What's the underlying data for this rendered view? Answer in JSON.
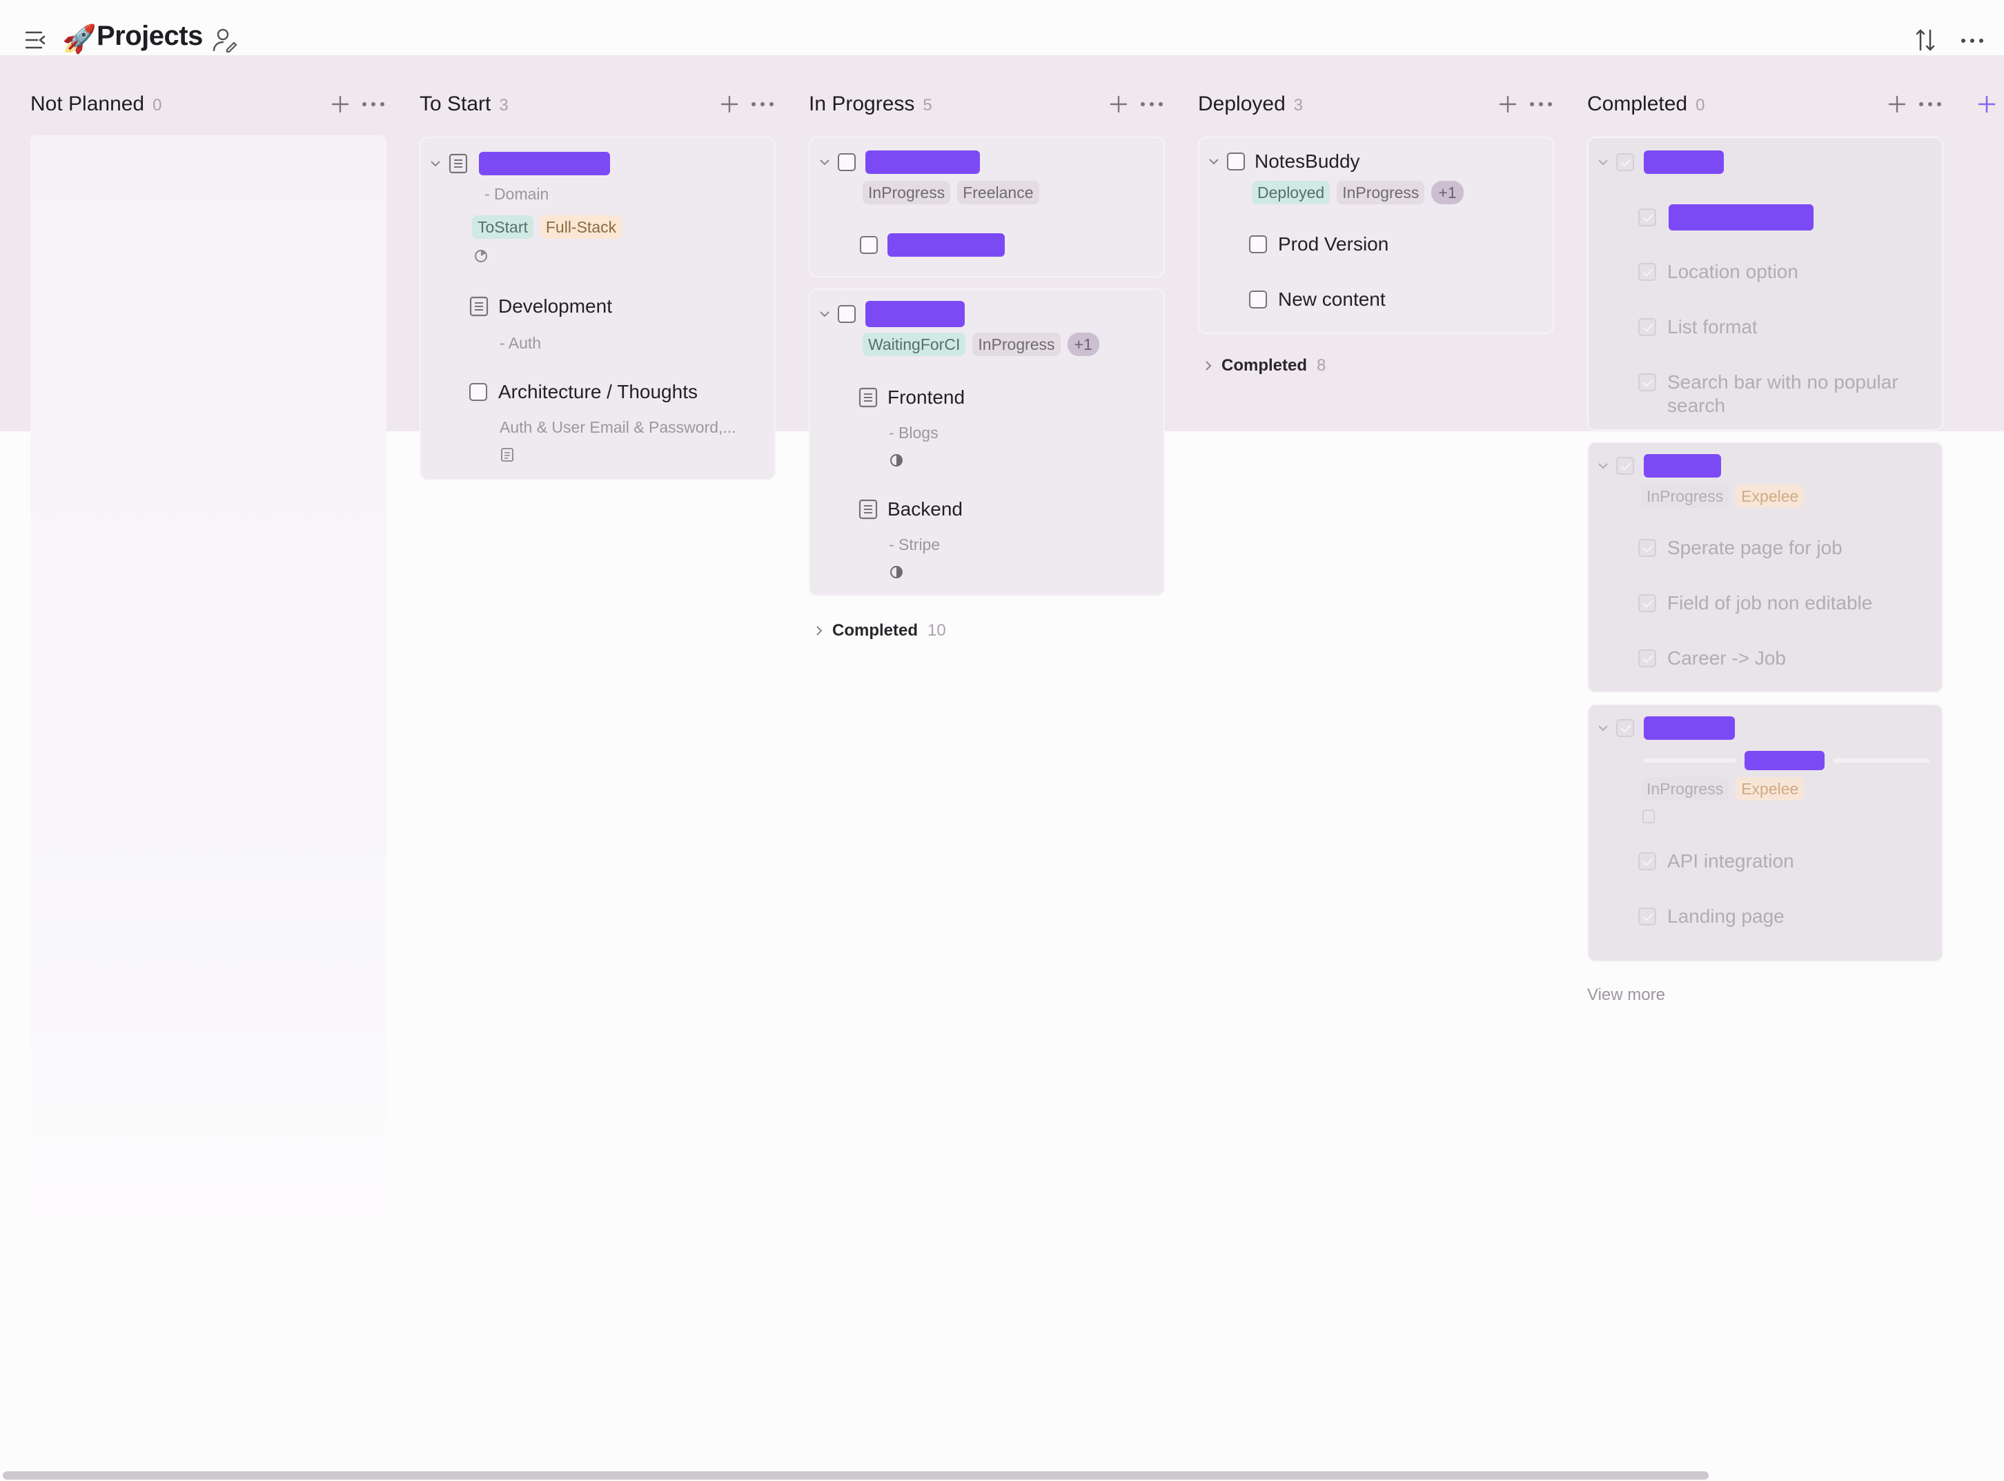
{
  "app": {
    "title": "Projects",
    "icons": [
      "menu-icon",
      "rocket-icon",
      "share-user-icon",
      "sort-icon",
      "more-icon"
    ]
  },
  "colors": {
    "accent": "#7c4af5",
    "band": "#efe9ee",
    "tag_teal": "#cfe9e3",
    "tag_orange": "#fbe7d3",
    "tag_gray": "#e3dde3"
  },
  "columns": [
    {
      "title": "Not Planned",
      "count": "0"
    },
    {
      "title": "To Start",
      "count": "3"
    },
    {
      "title": "In Progress",
      "count": "5"
    },
    {
      "title": "Deployed",
      "count": "3"
    },
    {
      "title": "Completed",
      "count": "0"
    }
  ],
  "to_start": {
    "card1": {
      "sub": "- Domain",
      "tags": [
        "ToStart",
        "Full-Stack"
      ],
      "child1_title": "Development",
      "child1_sub": "- Auth",
      "child2_title": "Architecture / Thoughts",
      "child2_sub": "Auth & User Email & Password,..."
    }
  },
  "in_progress": {
    "card1": {
      "tags": [
        "InProgress",
        "Freelance"
      ]
    },
    "card2": {
      "tags": [
        "WaitingForCI",
        "InProgress",
        "+1"
      ],
      "child1_title": "Frontend",
      "child1_sub": "- Blogs",
      "child2_title": "Backend",
      "child2_sub": "- Stripe"
    },
    "footer_label": "Completed",
    "footer_count": "10"
  },
  "deployed": {
    "card1": {
      "title": "NotesBuddy",
      "tags": [
        "Deployed",
        "InProgress",
        "+1"
      ],
      "child1_title": "Prod Version",
      "child2_title": "New content"
    },
    "footer_label": "Completed",
    "footer_count": "8"
  },
  "completed": {
    "card1": {
      "child2_title": "Location option",
      "child3_title": "List format",
      "child4_title_l1": "Search bar with no popular",
      "child4_title_l2": "search"
    },
    "card2": {
      "tags": [
        "InProgress",
        "Expelee"
      ],
      "child1_title": "Sperate page for job",
      "child2_title": "Field of job non editable",
      "child3_title": "Career -> Job"
    },
    "card3": {
      "tags": [
        "InProgress",
        "Expelee"
      ],
      "child1_title": "API integration",
      "child2_title": "Landing page"
    },
    "view_more": "View more"
  }
}
